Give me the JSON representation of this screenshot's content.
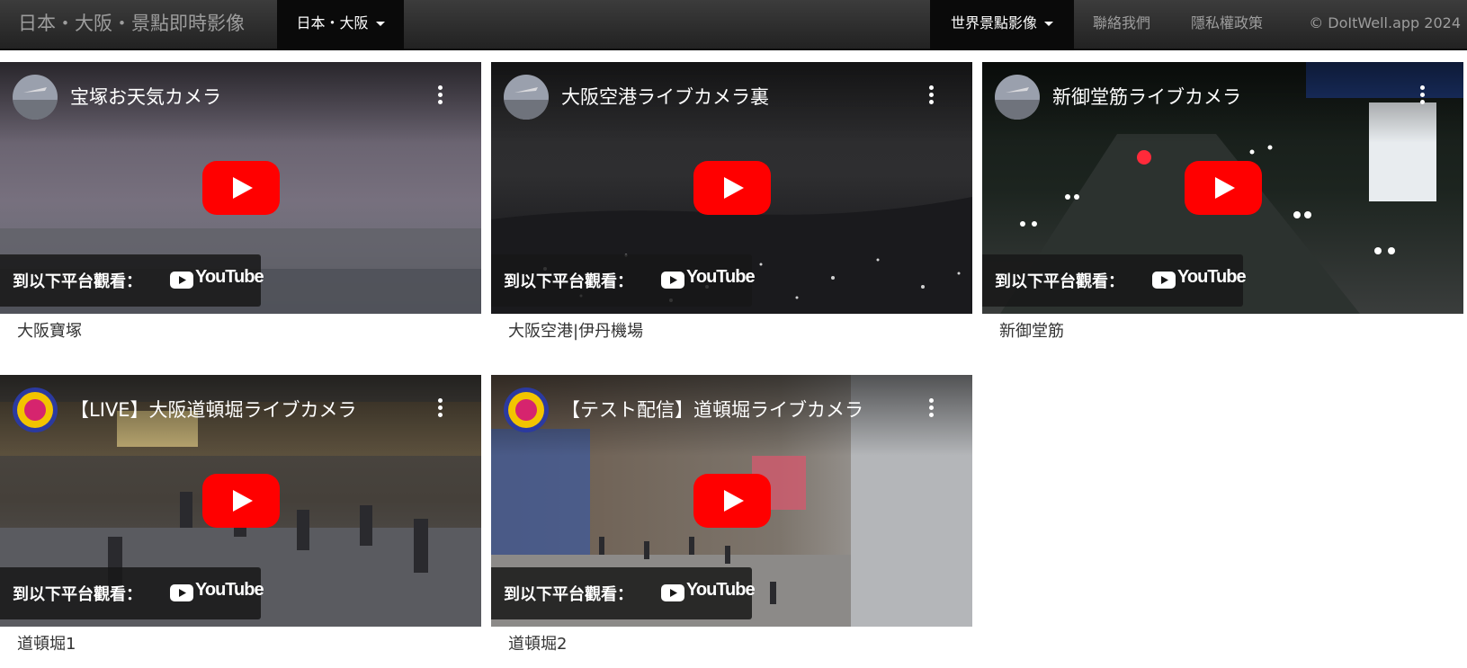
{
  "navbar": {
    "brand": "日本・大阪・景點即時影像",
    "region_menu": "日本・大阪",
    "world_menu": "世界景點影像",
    "contact": "聯絡我們",
    "privacy": "隱私權政策",
    "copyright": "© DoItWell.app 2024"
  },
  "player": {
    "watch_on": "到以下平台觀看：",
    "platform": "YouTube"
  },
  "videos": [
    {
      "title": "宝塚お天気カメラ",
      "caption": "大阪寶塚"
    },
    {
      "title": "大阪空港ライブカメラ裏",
      "caption": "大阪空港|伊丹機場"
    },
    {
      "title": "新御堂筋ライブカメラ",
      "caption": "新御堂筋"
    },
    {
      "title": "【LIVE】大阪道頓堀ライブカメラ",
      "caption": "道頓堀1"
    },
    {
      "title": "【テスト配信】道頓堀ライブカメラ",
      "caption": "道頓堀2"
    }
  ],
  "colors": {
    "navbar": "#222222",
    "youtube_red": "#ff0000"
  }
}
